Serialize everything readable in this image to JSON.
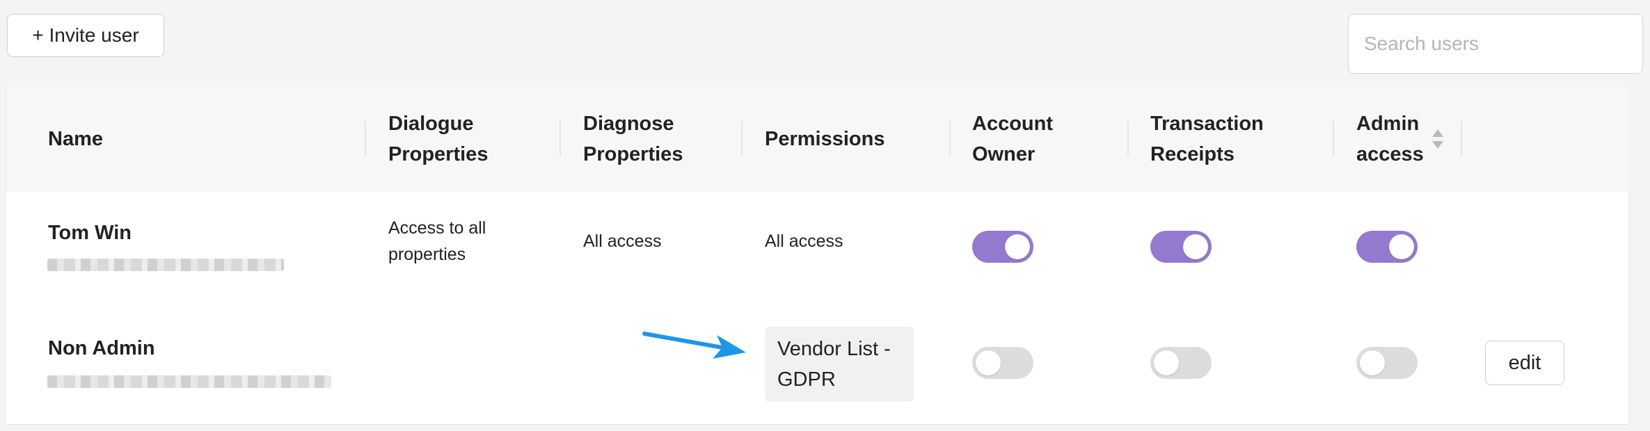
{
  "toolbar": {
    "invite_label": "+ Invite user",
    "search_placeholder": "Search users",
    "search_value": ""
  },
  "table": {
    "headers": [
      {
        "key": "name",
        "lines": [
          "Name"
        ]
      },
      {
        "key": "dialogue",
        "lines": [
          "Dialogue",
          "Properties"
        ]
      },
      {
        "key": "diagnose",
        "lines": [
          "Diagnose",
          "Properties"
        ]
      },
      {
        "key": "permissions",
        "lines": [
          "Permissions"
        ]
      },
      {
        "key": "account_owner",
        "lines": [
          "Account",
          "Owner"
        ]
      },
      {
        "key": "transaction_receipts",
        "lines": [
          "Transaction",
          "Receipts"
        ]
      },
      {
        "key": "admin_access",
        "lines": [
          "Admin",
          "access"
        ]
      }
    ],
    "rows": [
      {
        "name": "Tom Win",
        "dialogue": [
          "Access to all",
          "properties"
        ],
        "diagnose": "All access",
        "permissions": "All access",
        "account_owner": true,
        "transaction_receipts": true,
        "admin_access": true
      },
      {
        "name": "Non Admin",
        "permissions_chip": [
          "Vendor List -",
          "GDPR"
        ],
        "account_owner": false,
        "transaction_receipts": false,
        "admin_access": false,
        "edit_label": "edit"
      }
    ]
  },
  "colors": {
    "toggle_on": "#9479cf",
    "toggle_off": "#dcdcdc",
    "annotation_arrow": "#1e96e8"
  },
  "icons": {
    "sort": "sort-icon",
    "annotation": "arrow-icon"
  }
}
